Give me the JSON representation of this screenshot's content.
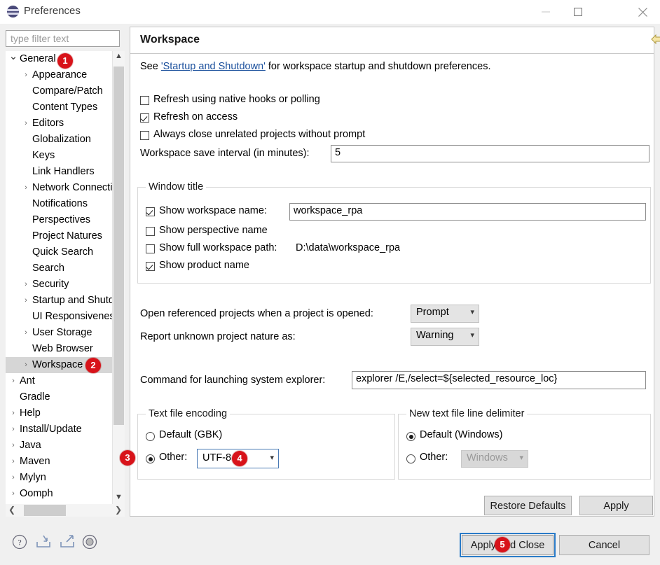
{
  "window": {
    "title": "Preferences",
    "icon": "preferences-icon",
    "minimize": "minimize-icon",
    "maximize": "maximize-icon",
    "close": "close-icon"
  },
  "filter": {
    "placeholder": "type filter text",
    "value": ""
  },
  "tree": {
    "items": [
      {
        "label": "General",
        "indent": 0,
        "arrow": "down",
        "selected": false
      },
      {
        "label": "Appearance",
        "indent": 1,
        "arrow": "right",
        "selected": false
      },
      {
        "label": "Compare/Patch",
        "indent": 1,
        "arrow": "none",
        "selected": false
      },
      {
        "label": "Content Types",
        "indent": 1,
        "arrow": "none",
        "selected": false
      },
      {
        "label": "Editors",
        "indent": 1,
        "arrow": "right",
        "selected": false
      },
      {
        "label": "Globalization",
        "indent": 1,
        "arrow": "none",
        "selected": false
      },
      {
        "label": "Keys",
        "indent": 1,
        "arrow": "none",
        "selected": false
      },
      {
        "label": "Link Handlers",
        "indent": 1,
        "arrow": "none",
        "selected": false
      },
      {
        "label": "Network Connections",
        "indent": 1,
        "arrow": "right",
        "selected": false
      },
      {
        "label": "Notifications",
        "indent": 1,
        "arrow": "none",
        "selected": false
      },
      {
        "label": "Perspectives",
        "indent": 1,
        "arrow": "none",
        "selected": false
      },
      {
        "label": "Project Natures",
        "indent": 1,
        "arrow": "none",
        "selected": false
      },
      {
        "label": "Quick Search",
        "indent": 1,
        "arrow": "none",
        "selected": false
      },
      {
        "label": "Search",
        "indent": 1,
        "arrow": "none",
        "selected": false
      },
      {
        "label": "Security",
        "indent": 1,
        "arrow": "right",
        "selected": false
      },
      {
        "label": "Startup and Shutdown",
        "indent": 1,
        "arrow": "right",
        "selected": false
      },
      {
        "label": "UI Responsiveness Monitoring",
        "indent": 1,
        "arrow": "none",
        "selected": false
      },
      {
        "label": "User Storage",
        "indent": 1,
        "arrow": "right",
        "selected": false
      },
      {
        "label": "Web Browser",
        "indent": 1,
        "arrow": "none",
        "selected": false
      },
      {
        "label": "Workspace",
        "indent": 1,
        "arrow": "right",
        "selected": true
      },
      {
        "label": "Ant",
        "indent": 0,
        "arrow": "right",
        "selected": false
      },
      {
        "label": "Gradle",
        "indent": 0,
        "arrow": "none",
        "selected": false
      },
      {
        "label": "Help",
        "indent": 0,
        "arrow": "right",
        "selected": false
      },
      {
        "label": "Install/Update",
        "indent": 0,
        "arrow": "right",
        "selected": false
      },
      {
        "label": "Java",
        "indent": 0,
        "arrow": "right",
        "selected": false
      },
      {
        "label": "Maven",
        "indent": 0,
        "arrow": "right",
        "selected": false
      },
      {
        "label": "Mylyn",
        "indent": 0,
        "arrow": "right",
        "selected": false
      },
      {
        "label": "Oomph",
        "indent": 0,
        "arrow": "right",
        "selected": false
      }
    ]
  },
  "bottom_icons": [
    {
      "name": "help-icon"
    },
    {
      "name": "import-icon"
    },
    {
      "name": "export-icon"
    },
    {
      "name": "target-icon"
    }
  ],
  "page": {
    "title": "Workspace",
    "nav": {
      "back": "back-arrow-icon",
      "back_menu": "back-dropdown-icon",
      "forward": "forward-arrow-icon",
      "forward_menu": "forward-dropdown-icon",
      "menu": "view-menu-icon"
    },
    "description_prefix": "See ",
    "description_link": "'Startup and Shutdown'",
    "description_suffix": " for workspace startup and shutdown preferences.",
    "checkboxes": [
      {
        "label": "Refresh using native hooks or polling",
        "checked": false
      },
      {
        "label": "Refresh on access",
        "checked": true
      },
      {
        "label": "Always close unrelated projects without prompt",
        "checked": false
      }
    ],
    "save_interval": {
      "label": "Workspace save interval (in minutes):",
      "value": "5"
    },
    "window_title_group": {
      "title": "Window title",
      "show_workspace_name": {
        "label": "Show workspace name:",
        "checked": true,
        "value": "workspace_rpa"
      },
      "show_perspective_name": {
        "label": "Show perspective name",
        "checked": false
      },
      "show_full_path": {
        "label": "Show full workspace path:",
        "checked": false,
        "value": "D:\\data\\workspace_rpa"
      },
      "show_product_name": {
        "label": "Show product name",
        "checked": true
      }
    },
    "open_referenced": {
      "label": "Open referenced projects when a project is opened:",
      "value": "Prompt"
    },
    "report_nature": {
      "label": "Report unknown project nature as:",
      "value": "Warning"
    },
    "explorer_command": {
      "label": "Command for launching system explorer:",
      "value": "explorer /E,/select=${selected_resource_loc}"
    },
    "encoding_group": {
      "title": "Text file encoding",
      "default_label": "Default (GBK)",
      "default_checked": false,
      "other_label": "Other:",
      "other_checked": true,
      "other_value": "UTF-8"
    },
    "delimiter_group": {
      "title": "New text file line delimiter",
      "default_label": "Default (Windows)",
      "default_checked": true,
      "other_label": "Other:",
      "other_checked": false,
      "other_value": "Windows"
    },
    "buttons": {
      "restore_defaults": "Restore Defaults",
      "apply": "Apply"
    }
  },
  "footer": {
    "apply_and_close": "Apply and Close",
    "cancel": "Cancel"
  },
  "badges": [
    {
      "number": "1"
    },
    {
      "number": "2"
    },
    {
      "number": "3"
    },
    {
      "number": "4"
    },
    {
      "number": "5"
    }
  ],
  "colors": {
    "badge_red": "#d8131a",
    "link_blue": "#1a4f9c",
    "focus_blue": "#2a7bc8",
    "selection_gray": "#d6d6d6"
  }
}
